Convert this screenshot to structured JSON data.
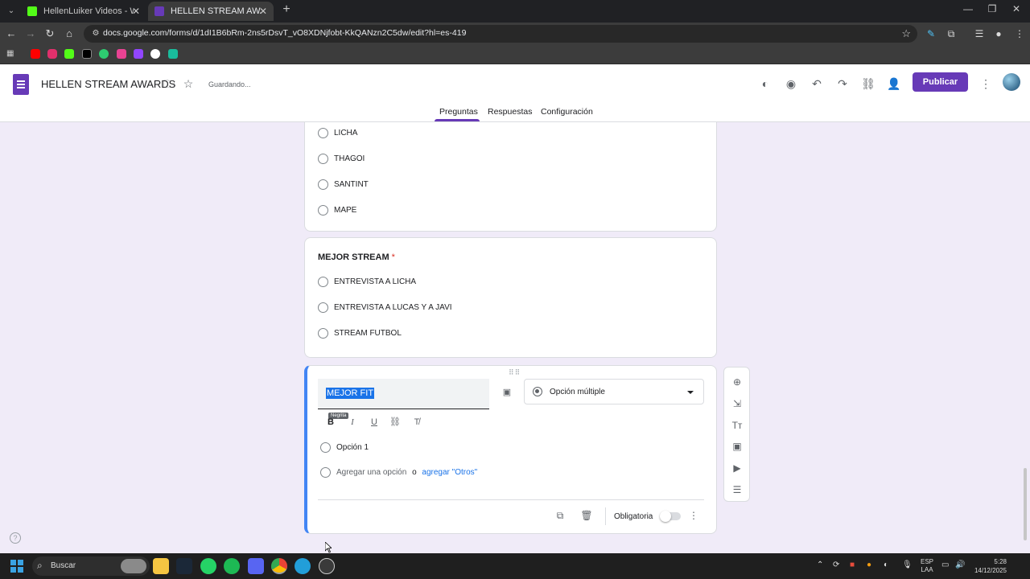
{
  "browser": {
    "tabs": [
      {
        "title": "HellenLuiker Videos - Watch Or",
        "favicon_color": "#53fc18"
      },
      {
        "title": "HELLEN STREAM AWARDS - For",
        "favicon_color": "#673ab7"
      }
    ],
    "url": "docs.google.com/forms/d/1dI1B6bRm-2ns5rDsvT_vO8XDNjfobt-KkQANzn2C5dw/edit?hl=es-419"
  },
  "form": {
    "title": "HELLEN STREAM AWARDS",
    "status": "Guardando...",
    "publish_label": "Publicar",
    "tabs": [
      "Preguntas",
      "Respuestas",
      "Configuración"
    ],
    "accent_color": "#673ab7"
  },
  "questions": [
    {
      "options": [
        "LICHA",
        "THAGOI",
        "SANTINT",
        "MAPE"
      ]
    },
    {
      "title": "MEJOR STREAM",
      "required_mark": "*",
      "options": [
        "ENTREVISTA A LICHA",
        "ENTREVISTA A LUCAS Y A JAVI",
        "STREAM FUTBOL"
      ]
    },
    {
      "title": "MEJOR FIT",
      "tooltip": "Negrita",
      "type": "Opción múltiple",
      "options": [
        "Opción 1"
      ],
      "add_option": "Agregar una opción",
      "or_text": "o",
      "add_other": "agregar \"Otros\"",
      "required_label": "Obligatoria",
      "required": false
    }
  ],
  "taskbar": {
    "search_label": "Buscar",
    "lang": [
      "ESP",
      "LAA"
    ],
    "time": "5:28",
    "date": "14/12/2025"
  }
}
